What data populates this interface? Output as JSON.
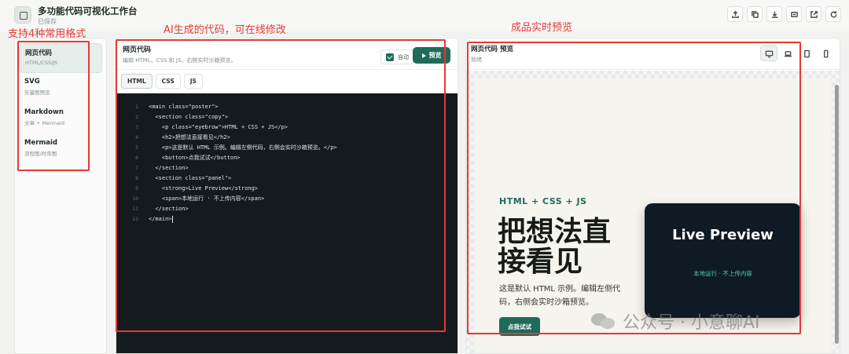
{
  "app": {
    "title": "多功能代码可视化工作台",
    "status": "已保存"
  },
  "top_actions": [
    "upload-icon",
    "copy-icon",
    "download-icon",
    "image-export-icon",
    "external-open-icon",
    "refresh-icon"
  ],
  "sidebar": {
    "items": [
      {
        "label": "网页代码",
        "desc": "HTML/CSS/JS",
        "active": true
      },
      {
        "label": "SVG",
        "desc": "矢量图预览",
        "active": false
      },
      {
        "label": "Markdown",
        "desc": "文章 + Mermaid",
        "active": false
      },
      {
        "label": "Mermaid",
        "desc": "流程图/时序图",
        "active": false
      }
    ]
  },
  "editor": {
    "title": "网页代码",
    "subtitle": "编辑 HTML、CSS 和 JS，右侧实时沙箱预览。",
    "auto_label": "自动",
    "auto_checked": true,
    "preview_button": "预览",
    "tabs": [
      "HTML",
      "CSS",
      "JS"
    ],
    "active_tab": "HTML",
    "line_numbers": [
      "1",
      "2",
      "3",
      "4",
      "5",
      "6",
      "7",
      "8",
      "9",
      "10",
      "11",
      "12"
    ],
    "code_lines": [
      "<main class=\"poster\">",
      "  <section class=\"copy\">",
      "    <p class=\"eyebrow\">HTML + CSS + JS</p>",
      "    <h2>把想法直接看见</h2>",
      "    <p>这是默认 HTML 示例。编辑左侧代码，右侧会实时沙箱预览。</p>",
      "    <button>点我试试</button>",
      "  </section>",
      "  <section class=\"panel\">",
      "    <strong>Live Preview</strong>",
      "    <span>本地运行 · 不上传内容</span>",
      "  </section>",
      "</main>"
    ]
  },
  "preview": {
    "title": "网页代码 预览",
    "status": "就绪",
    "devices": [
      "desktop-icon",
      "laptop-icon",
      "tablet-icon",
      "phone-icon"
    ],
    "active_device": "desktop-icon",
    "poster": {
      "eyebrow": "HTML + CSS + JS",
      "headline": "把想法直接看见",
      "intro": "这是默认 HTML 示例。编辑左侧代码，右侧会实时沙箱预览。",
      "button": "点我试试",
      "panel_title": "Live Preview",
      "panel_sub": "本地运行 · 不上传内容"
    }
  },
  "annotations": {
    "formats": "支持4种常用格式",
    "editor": "AI生成的代码，可在线修改",
    "preview": "成品实时预览"
  },
  "watermark": "公众号 · 小意聊AI",
  "colors": {
    "accent": "#1e6b5a",
    "annotation": "#e53935",
    "code_bg": "#141a1e",
    "panel_bg": "#0f1a24",
    "panel_sub": "#4fd1b0"
  }
}
